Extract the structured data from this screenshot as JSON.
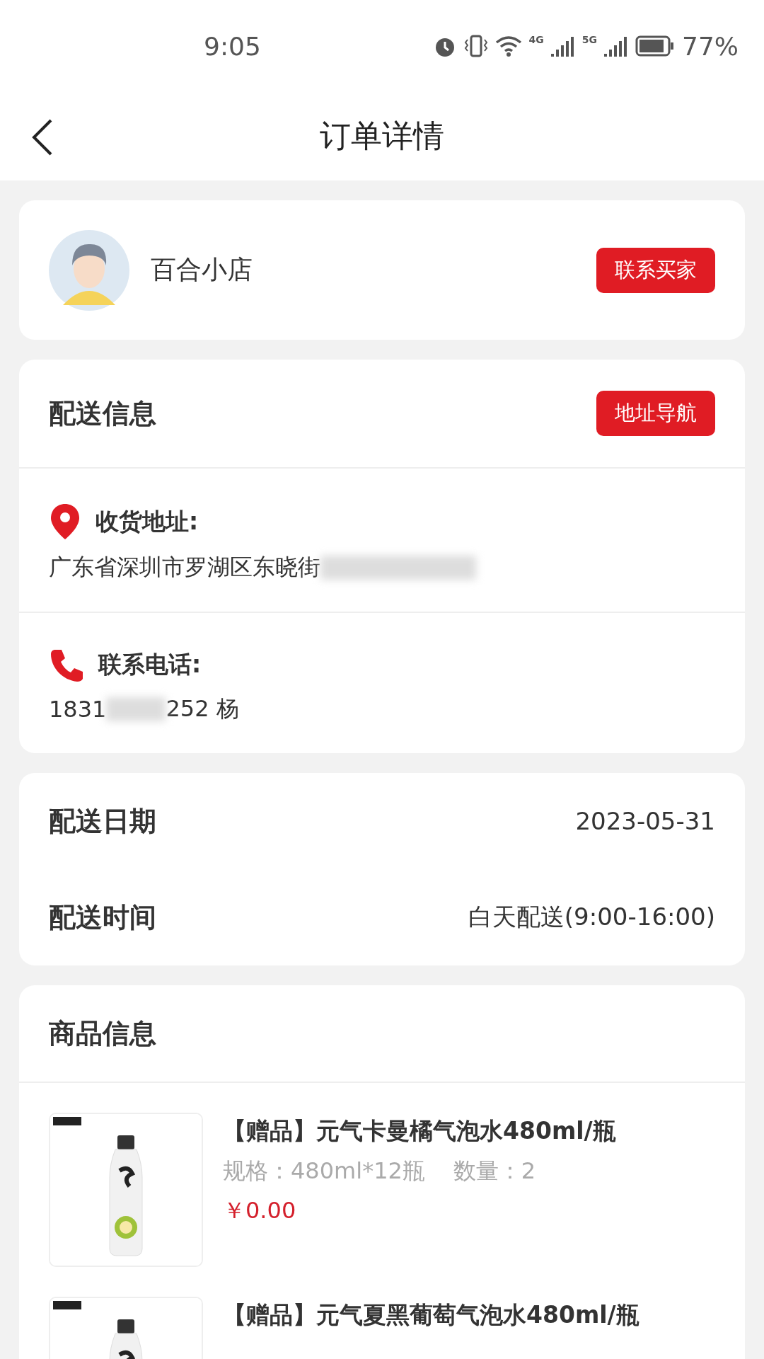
{
  "status_bar": {
    "time": "9:05",
    "battery": "77%",
    "network_labels": [
      "4G",
      "5G"
    ]
  },
  "header": {
    "title": "订单详情"
  },
  "buyer": {
    "name": "百合小店",
    "button": "联系买家"
  },
  "delivery": {
    "title": "配送信息",
    "button": "地址导航",
    "address_label": "收货地址:",
    "address": "广东省深圳市罗湖区东晓街",
    "phone_label": "联系电话:",
    "phone_start": "1831",
    "phone_end": "252 杨"
  },
  "schedule": [
    {
      "label": "配送日期",
      "value": "2023-05-31"
    },
    {
      "label": "配送时间",
      "value": "白天配送(9:00-16:00)"
    }
  ],
  "goods": {
    "title": "商品信息",
    "items": [
      {
        "name": "【赠品】元气卡曼橘气泡水480ml/瓶",
        "spec": "规格：480ml*12瓶",
        "qty": "数量：2",
        "price": "￥0.00"
      },
      {
        "name": "【赠品】元气夏黑葡萄气泡水480ml/瓶"
      }
    ]
  }
}
